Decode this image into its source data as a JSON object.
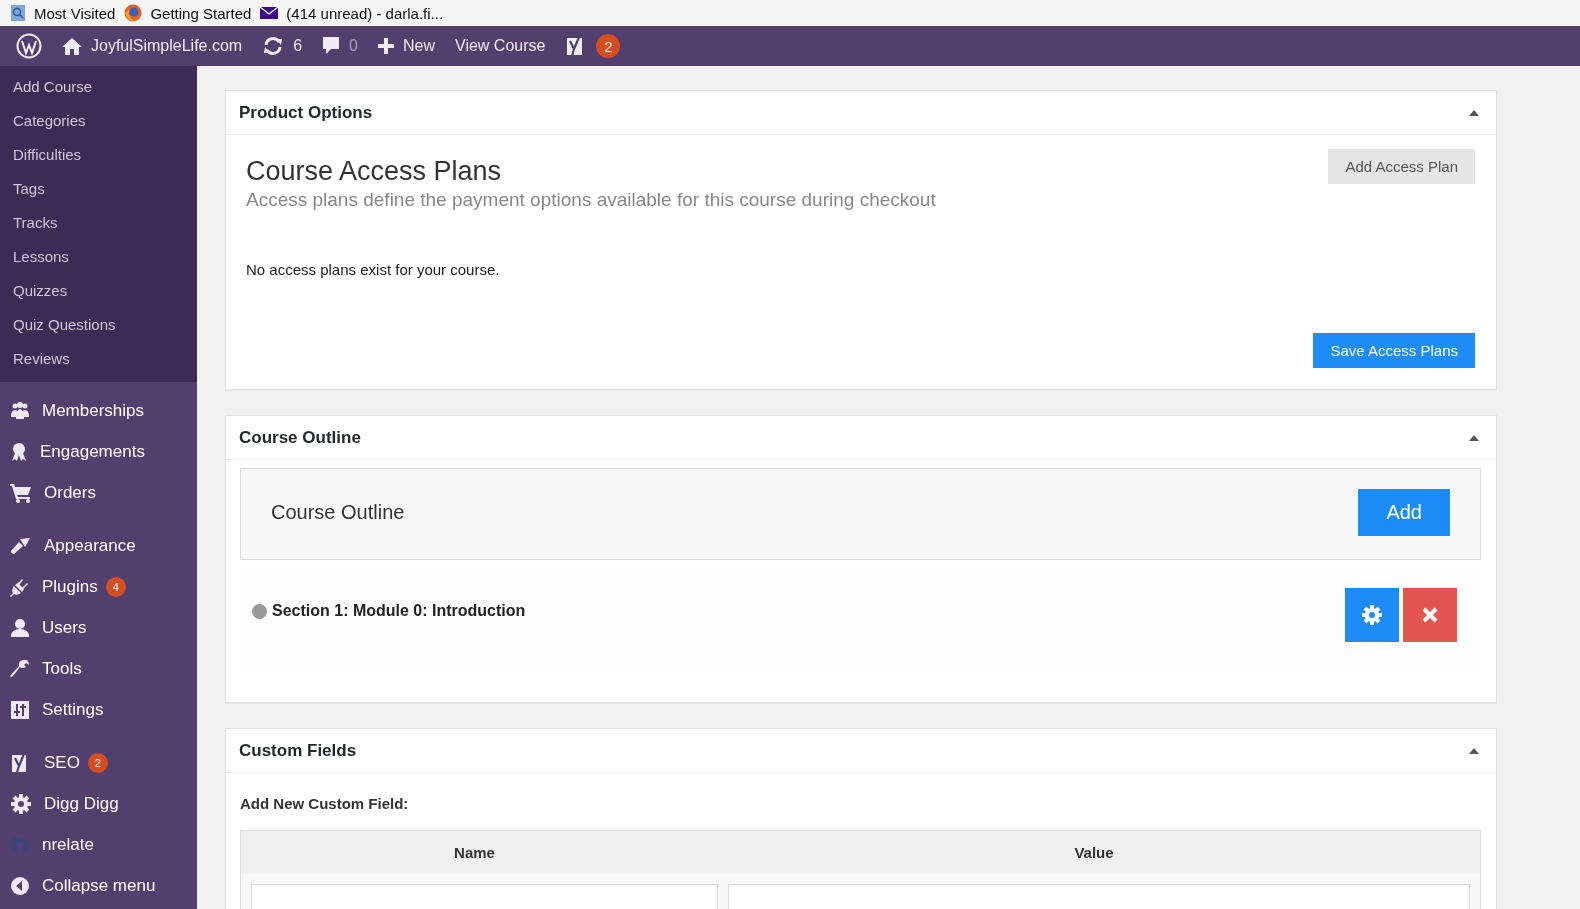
{
  "bookmarks_bar": {
    "items": [
      {
        "label": "Most Visited"
      },
      {
        "label": "Getting Started"
      },
      {
        "label": "(414 unread) - darla.fi..."
      }
    ]
  },
  "admin_bar": {
    "site": "JoyfulSimpleLife.com",
    "updates": "6",
    "comments": "0",
    "new": "New",
    "view": "View Course",
    "seo_badge": "2"
  },
  "sidebar": {
    "submenu": [
      {
        "label": "Add Course"
      },
      {
        "label": "Categories"
      },
      {
        "label": "Difficulties"
      },
      {
        "label": "Tags"
      },
      {
        "label": "Tracks"
      },
      {
        "label": "Lessons"
      },
      {
        "label": "Quizzes"
      },
      {
        "label": "Quiz Questions"
      },
      {
        "label": "Reviews"
      }
    ],
    "menu": [
      {
        "label": "Memberships",
        "group_start": false
      },
      {
        "label": "Engagements",
        "group_start": false
      },
      {
        "label": "Orders",
        "group_start": false
      },
      {
        "label": "Appearance",
        "group_start": true
      },
      {
        "label": "Plugins",
        "badge": "4",
        "group_start": false
      },
      {
        "label": "Users",
        "group_start": false
      },
      {
        "label": "Tools",
        "group_start": false
      },
      {
        "label": "Settings",
        "group_start": false
      },
      {
        "label": "SEO",
        "badge": "2",
        "group_start": true
      },
      {
        "label": "Digg Digg",
        "group_start": false
      },
      {
        "label": "nrelate",
        "group_start": false
      },
      {
        "label": "Collapse menu",
        "group_start": false
      }
    ]
  },
  "product_options": {
    "title": "Product Options",
    "heading": "Course Access Plans",
    "description": "Access plans define the payment options available for this course during checkout",
    "add_button": "Add Access Plan",
    "empty_message": "No access plans exist for your course.",
    "save_button": "Save Access Plans"
  },
  "course_outline": {
    "title": "Course Outline",
    "box_title": "Course Outline",
    "add_button": "Add",
    "sections": [
      {
        "title": "Section 1: Module 0: Introduction"
      }
    ]
  },
  "custom_fields": {
    "title": "Custom Fields",
    "label": "Add New Custom Field:",
    "columns": [
      "Name",
      "Value"
    ]
  }
}
